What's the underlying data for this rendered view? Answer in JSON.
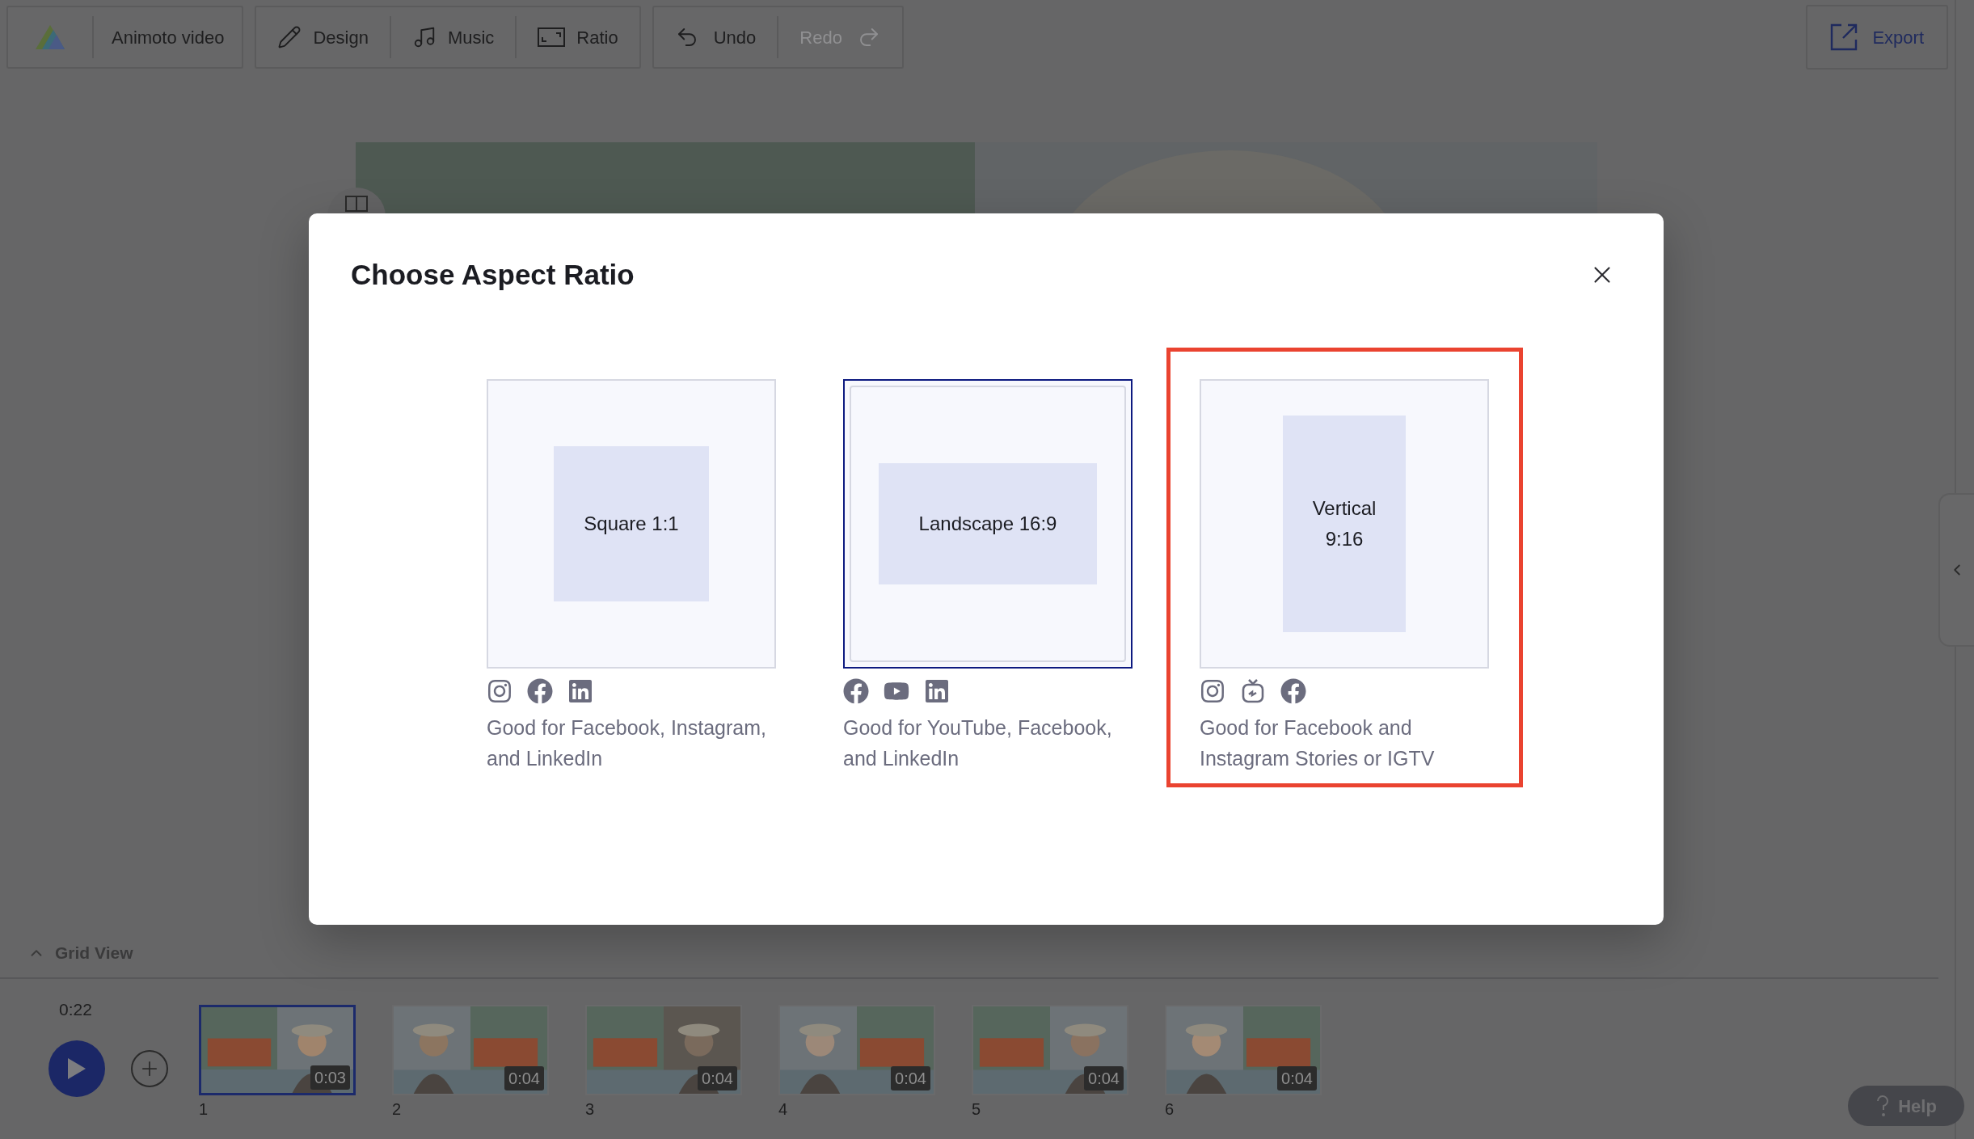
{
  "toolbar": {
    "project_title": "Animoto video",
    "tools": [
      {
        "kind": "design",
        "label": "Design"
      },
      {
        "kind": "music",
        "label": "Music"
      },
      {
        "kind": "ratio",
        "label": "Ratio"
      }
    ],
    "history": [
      {
        "kind": "undo",
        "label": "Undo",
        "disabled": false
      },
      {
        "kind": "redo",
        "label": "Redo",
        "disabled": true
      }
    ],
    "export": "Export"
  },
  "dialog": {
    "title": "Choose Aspect Ratio",
    "options": [
      {
        "label": "Square 1:1",
        "kind": "square",
        "selected": false,
        "highlighted": false,
        "platforms": [
          {
            "kind": "instagram"
          },
          {
            "kind": "facebook"
          },
          {
            "kind": "linkedin"
          }
        ],
        "description": "Good for Facebook, Instagram, and LinkedIn"
      },
      {
        "label": "Landscape 16:9",
        "kind": "landscape",
        "selected": true,
        "highlighted": false,
        "platforms": [
          {
            "kind": "facebook"
          },
          {
            "kind": "youtube"
          },
          {
            "kind": "linkedin"
          }
        ],
        "description": "Good for YouTube, Facebook, and LinkedIn"
      },
      {
        "label": "Vertical 9:16",
        "kind": "vertical",
        "selected": false,
        "highlighted": true,
        "platforms": [
          {
            "kind": "instagram"
          },
          {
            "kind": "igtv"
          },
          {
            "kind": "facebook"
          }
        ],
        "description": "Good for Facebook and Instagram Stories or IGTV"
      }
    ]
  },
  "timeline": {
    "grid_view": "Grid View",
    "total_duration": "0:22",
    "scenes": [
      {
        "number": "1",
        "duration": "0:03",
        "selected": true
      },
      {
        "number": "2",
        "duration": "0:04",
        "selected": false
      },
      {
        "number": "3",
        "duration": "0:04",
        "selected": false
      },
      {
        "number": "4",
        "duration": "0:04",
        "selected": false
      },
      {
        "number": "5",
        "duration": "0:04",
        "selected": false
      },
      {
        "number": "6",
        "duration": "0:04",
        "selected": false
      }
    ]
  },
  "help": "Help"
}
